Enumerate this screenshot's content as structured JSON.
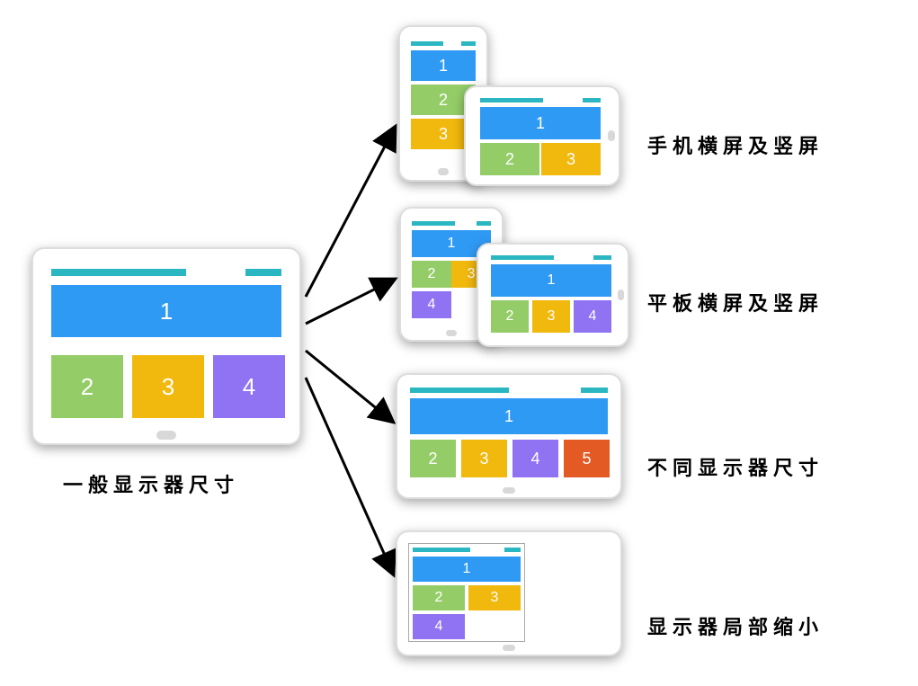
{
  "captions": {
    "main": "一般显示器尺寸",
    "phone": "手机横屏及竖屏",
    "tablet": "平板横屏及竖屏",
    "monitor": "不同显示器尺寸",
    "shrink": "显示器局部缩小"
  },
  "devices": {
    "main": {
      "blocks": [
        "1",
        "2",
        "3",
        "4"
      ]
    },
    "phone_p": {
      "blocks": [
        "1",
        "2",
        "3"
      ]
    },
    "phone_l": {
      "blocks": [
        "1",
        "2",
        "3"
      ]
    },
    "tablet_p": {
      "blocks": [
        "1",
        "2",
        "3",
        "4"
      ]
    },
    "tablet_l": {
      "blocks": [
        "1",
        "2",
        "3",
        "4"
      ]
    },
    "monitor": {
      "blocks": [
        "1",
        "2",
        "3",
        "4",
        "5"
      ]
    },
    "shrink": {
      "blocks": [
        "1",
        "2",
        "3",
        "4"
      ]
    }
  },
  "colors": {
    "blue": "#2f9af3",
    "green": "#94cd68",
    "orange": "#f1b80d",
    "purple": "#8f73f3",
    "red": "#e35a24",
    "teal": "#2bb7c1"
  }
}
